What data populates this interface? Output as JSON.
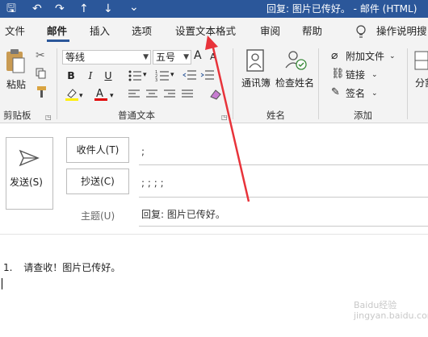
{
  "titlebar": {
    "title": "回复: 图片已传好。  -  邮件 (HTML)",
    "save_glyph": "🖫",
    "undo_glyph": "↶",
    "redo_glyph": "↷",
    "up_glyph": "↑",
    "down_glyph": "↓",
    "more_glyph": "⌄"
  },
  "tabs": [
    "文件",
    "邮件",
    "插入",
    "选项",
    "设置文本格式",
    "审阅",
    "帮助"
  ],
  "tell_me": "操作说明搜",
  "ribbon": {
    "clipboard": {
      "paste": "粘贴",
      "label": "剪贴板"
    },
    "font": {
      "name": "等线",
      "size": "五号",
      "label": "普通文本",
      "grow": "A",
      "shrink": "A",
      "bold": "B",
      "italic": "I",
      "underline": "U"
    },
    "names": {
      "address_book": "通讯簿",
      "check_names": "检查姓名",
      "label": "姓名"
    },
    "include": {
      "attach": "附加文件",
      "link": "链接",
      "signature": "签名",
      "label": "添加"
    },
    "split": "分割"
  },
  "compose": {
    "send": "发送(S)",
    "to_label": "收件人(T)",
    "to_value": ";",
    "cc_label": "抄送(C)",
    "cc_value": "; ; ; ;",
    "subject_label": "主题(U)",
    "subject_value": "回复: 图片已传好。",
    "body_marker": "1.",
    "body_text": "请查收！图片已传好。"
  },
  "watermark": "Baidu经验\njingyan.baidu.com",
  "colors": {
    "titlebar": "#2b579a",
    "ribbon": "#f3f3f3",
    "annotation_arrow": "#e8333a",
    "highlight": "#ffef00",
    "font_color": "#e00000"
  }
}
